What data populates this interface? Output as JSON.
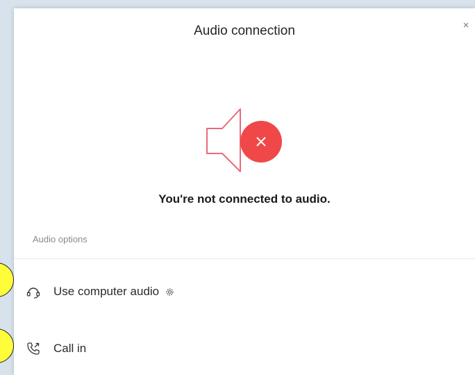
{
  "dialog": {
    "title": "Audio connection",
    "close_symbol": "×",
    "message": "You're not connected to audio.",
    "section_label": "Audio options"
  },
  "options": [
    {
      "label": "Use computer audio",
      "icon": "headset-icon",
      "has_settings": true
    },
    {
      "label": "Call in",
      "icon": "phone-call-icon",
      "has_settings": false
    }
  ],
  "colors": {
    "error_red": "#f04848",
    "speaker_outline": "#e86a7a",
    "callout_yellow": "#fffc3a",
    "background": "#d7e2ec"
  },
  "icons": [
    "speaker-muted-icon",
    "error-x-icon",
    "headset-icon",
    "gear-icon",
    "phone-call-icon"
  ]
}
